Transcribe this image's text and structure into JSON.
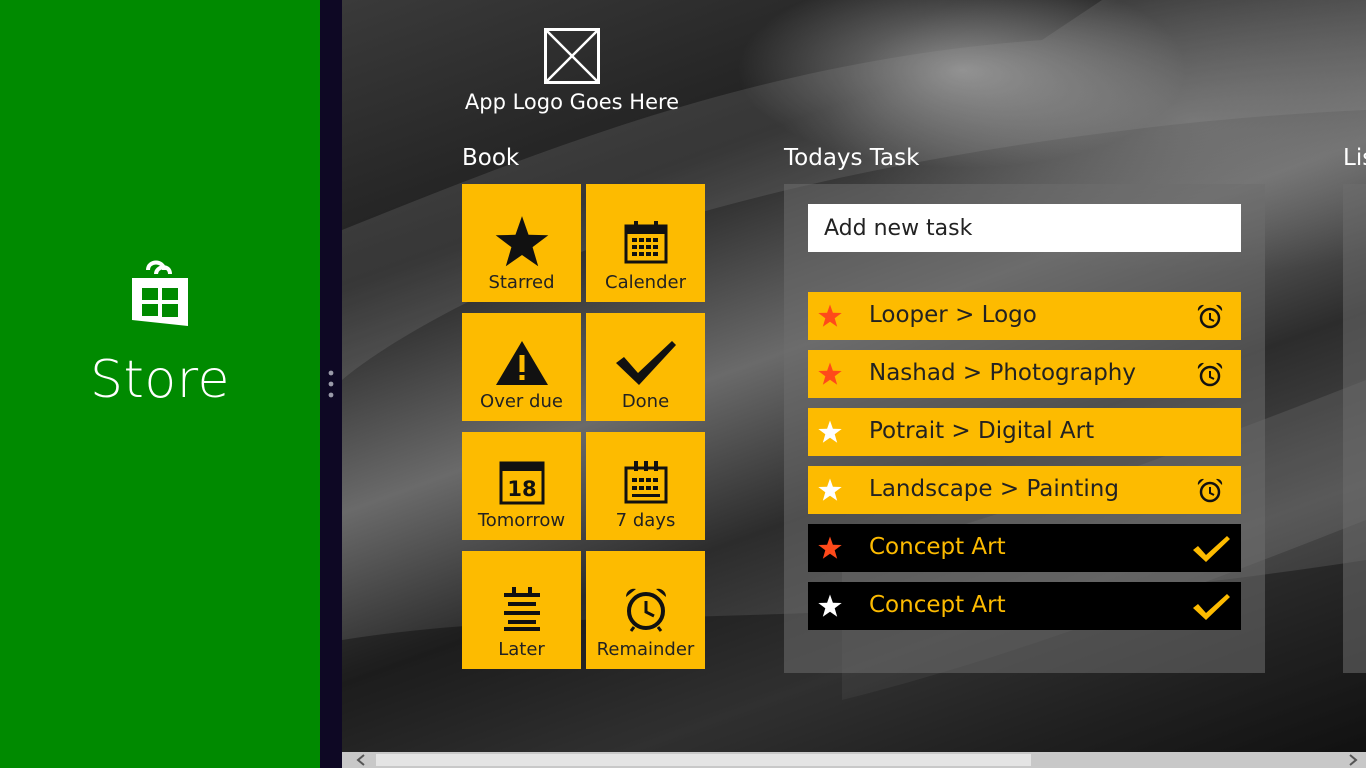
{
  "store": {
    "title": "Store",
    "icon": "store-bag-icon",
    "color": "#008a00"
  },
  "app": {
    "logo_text": "App Logo Goes Here",
    "accent": "#fdbb00"
  },
  "book": {
    "heading": "Book",
    "tiles": [
      {
        "label": "Starred",
        "icon": "star-icon"
      },
      {
        "label": "Calender",
        "icon": "calendar-icon"
      },
      {
        "label": "Over due",
        "icon": "warning-icon"
      },
      {
        "label": "Done",
        "icon": "checkmark-icon"
      },
      {
        "label": "Tomorrow",
        "icon": "calendar-date-icon",
        "icon_text": "18"
      },
      {
        "label": "7 days",
        "icon": "calendar-week-icon"
      },
      {
        "label": "Later",
        "icon": "list-icon"
      },
      {
        "label": "Remainder",
        "icon": "alarm-clock-icon"
      }
    ]
  },
  "today": {
    "heading": "Todays Task",
    "input_placeholder": "Add new task",
    "tasks": [
      {
        "label": "Looper > Logo",
        "star_color": "#ff4a1a",
        "style": "yellow",
        "trailing": "alarm-icon"
      },
      {
        "label": "Nashad > Photography",
        "star_color": "#ff4a1a",
        "style": "yellow",
        "trailing": "alarm-icon"
      },
      {
        "label": "Potrait > Digital Art",
        "star_color": "#ffffff",
        "style": "yellow",
        "trailing": ""
      },
      {
        "label": "Landscape > Painting",
        "star_color": "#ffffff",
        "style": "yellow",
        "trailing": "alarm-icon"
      },
      {
        "label": "Concept Art",
        "star_color": "#ff4a1a",
        "style": "black",
        "trailing": "checkmark-icon"
      },
      {
        "label": "Concept Art",
        "star_color": "#ffffff",
        "style": "black",
        "trailing": "checkmark-icon"
      }
    ]
  },
  "list": {
    "heading": "Lis"
  }
}
